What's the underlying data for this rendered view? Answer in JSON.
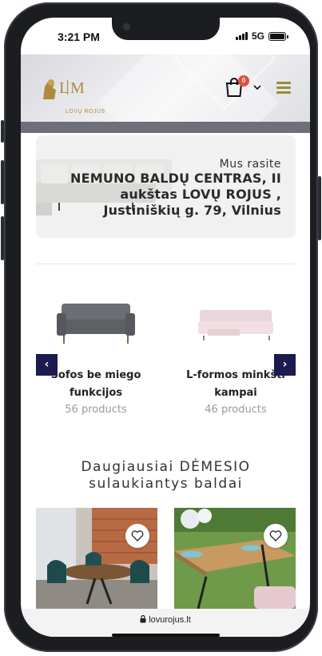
{
  "status": {
    "time": "3:21 PM",
    "network": "5G"
  },
  "header": {
    "logo_text": "LOVŲ ROJUS",
    "cart_count": "0"
  },
  "banner": {
    "subtitle": "Mus rasite",
    "title": "NEMUNO BALDŲ CENTRAS, II aukštas LOVŲ ROJUS , Justiniškių g. 79, Vilnius"
  },
  "categories": [
    {
      "name": "Sofos be miego funkcijos",
      "count": "56 products",
      "icon": "grey-sofa-image"
    },
    {
      "name": "L-formos minkšti kampai",
      "count": "46 products",
      "icon": "pink-sofa-image"
    }
  ],
  "nav": {
    "prev": "‹",
    "next": "›"
  },
  "section": {
    "title": "Daugiausiai DĖMESIO sulaukiantys baldai"
  },
  "products": [
    {
      "icon": "dining-set-image"
    },
    {
      "icon": "outdoor-table-image"
    }
  ],
  "browser": {
    "url": "lovurojus.lt"
  },
  "colors": {
    "accent_navy": "#1c1a4e",
    "gold": "#b08a3c",
    "badge": "#e74c3c"
  }
}
